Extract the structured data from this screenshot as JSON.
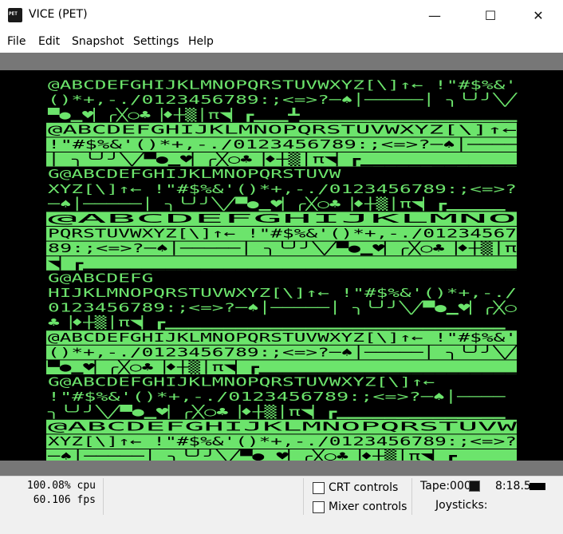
{
  "window": {
    "title": "VICE (PET)",
    "icon_text": "PET",
    "icon": "pet-app-icon"
  },
  "titlebar_buttons": {
    "minimize": "—",
    "maximize": "☐",
    "close": "✕"
  },
  "menu": [
    "File",
    "Edit",
    "Snapshot",
    "Settings",
    "Help"
  ],
  "screen": {
    "phosphor_color": "#6ce46c",
    "background_color": "#000000",
    "border_color": "#777777",
    "lines": [
      "@ABCDEFGHIJKLMNOPQRSTUVWXYZ[\\]↑← !\"#$%&'",
      "()*+,-./0123456789:;<=>?─♠│─────│ ╮╰╯╯╲╱",
      "▀●▁♥▏╭╳○♣▕♦┼▒│π◥▏┏▁▁▁┻▁▁▁▁▁▁▁▁▁▁▁▁▁▁▁▁▁▁▁",
      "",
      "",
      "",
      "G@ABCDEFGHIJKLMNOPQRSTUVW",
      "XYZ[\\]↑← !\"#$%&'()*+,-./0123456789:;<=>?",
      "─♠│─────│ ╮╰╯╯╲╱▀●▁♥▏╭╳○♣▕♦┼▒│π◥▏┏▁▁▁▁▁",
      "",
      "",
      "",
      "",
      "G@ABCDEFG",
      "HIJKLMNOPQRSTUVWXYZ[\\]↑← !\"#$%&'()*+,-./",
      "0123456789:;<=>?─♠│─────│ ╮╰╯╯╲╱▀●▁♥▏╭╳○",
      "♣▕♦┼▒│π◥▏┏▁▁▁▁▁▁▁▁▁▁▁▁▁▁▁▁▁▁▁▁▁▁▁▁▁▁▁▁▁",
      "",
      "",
      "",
      "G@ABCDEFGHIJKLMNOPQRSTUVWXYZ[\\]↑←",
      " !\"#$%&'()*+,-./0123456789:;<=>?─♠│────",
      " ╮╰╯╯╲╱▀●▁♥▏╭╳○♣▕♦┼▒│π◥▏┏▁▁▁▁▁▁▁▁▁▁▁▁▁▁",
      "",
      "",
      ""
    ],
    "reverse_bands": [
      {
        "row": 3,
        "text": "@ABCDEFGHIJKLMNOPQRSTUVWXYZ[\\]↑← "
      },
      {
        "row": 4,
        "text": " !\"#$%&'()*+,-./0123456789:;<=>?─♠│────"
      },
      {
        "row": 5,
        "text": "│ ╮╰╯╯╲╱▀●▁♥▏╭╳○♣▕♦┼▒│π◥▏┏▁▁▁▁▁▁▁▁▁▁▁▁▁"
      },
      {
        "row": 9,
        "text": "@ABCDEFGHIJKLMNO"
      },
      {
        "row": 10,
        "text": "PQRSTUVWXYZ[\\]↑← !\"#$%&'()*+,-./01234567"
      },
      {
        "row": 11,
        "text": "89:;<=>?─♠│─────│ ╮╰╯╯╲╱▀●▁♥▏╭╳○♣▕♦┼▒│π"
      },
      {
        "row": 12,
        "text": "◥▏┏▁▁▁▁▁▁▁▁▁▁▁▁▁▁▁▁▁▁▁▁▁▁▁▁▁▁▁▁▁▁▁▁▁▁▁▁▁"
      },
      {
        "row": 17,
        "text": "@ABCDEFGHIJKLMNOPQRSTUVWXYZ[\\]↑← !\"#$%&'"
      },
      {
        "row": 18,
        "text": "()*+,-./0123456789:;<=>?─♠│─────│ ╮╰╯╯╲╱"
      },
      {
        "row": 19,
        "text": "▀●▁♥▏╭╳○♣▕♦┼▒│π◥▏┏▁▁▁▁▁▁▁▁▁▁▁▁▁▁▁▁▁▁▁▁▁▁"
      },
      {
        "row": 23,
        "text": "@ABCDEFGHIJKLMNOPQRSTUVW"
      },
      {
        "row": 24,
        "text": "XYZ[\\]↑← !\"#$%&'()*+,-./0123456789:;<=>?"
      },
      {
        "row": 25,
        "text": "─♠│─────│ ╮╰╯╯╲╱▀●▁♥▏╭╳○♣▕♦┼▒│π◥▏┏▁▁▁▁▁"
      }
    ]
  },
  "status": {
    "cpu": "100.08% cpu",
    "fps": "60.106 fps",
    "crt_controls": "CRT controls",
    "mixer_controls": "Mixer controls",
    "tape": "Tape:000",
    "tape_time": "8:18.5",
    "joysticks": "Joysticks:"
  }
}
